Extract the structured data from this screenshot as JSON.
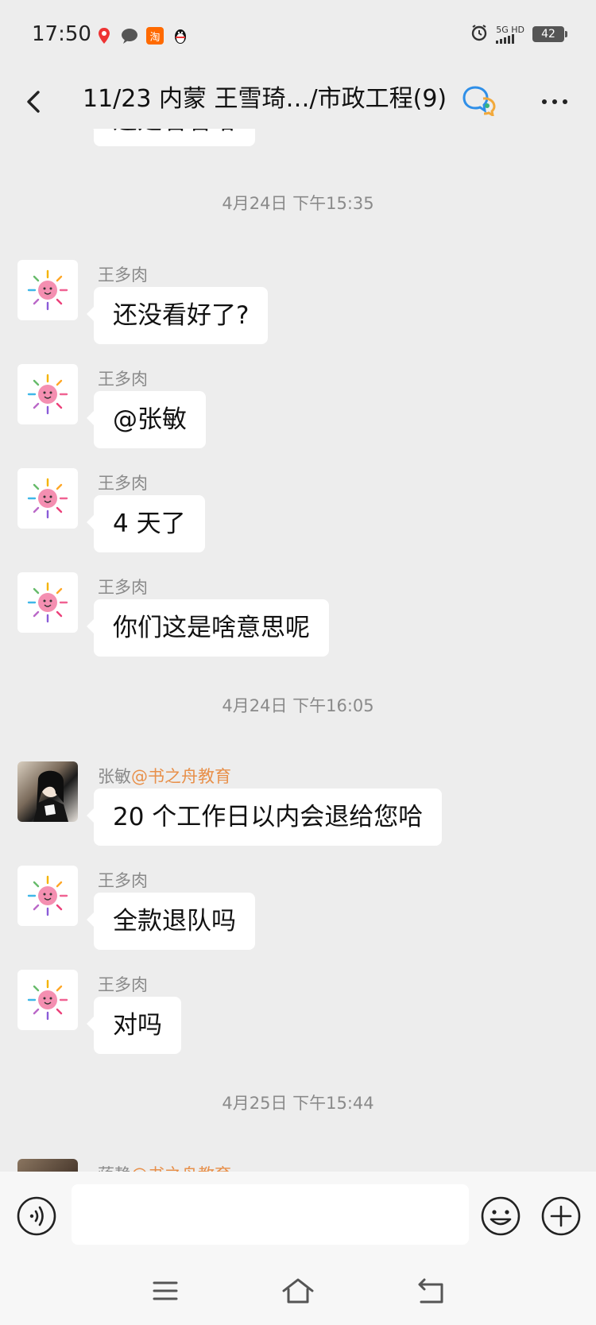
{
  "status_bar": {
    "time": "17:50",
    "notification_icons": [
      "location-pin-icon",
      "chat-bubble-icon",
      "taobao-icon",
      "qq-penguin-icon"
    ],
    "taobao_glyph": "淘",
    "network_label": "5G HD",
    "battery": "42"
  },
  "header": {
    "title": "11/23 内蒙 王雪琦…/市政工程(9)",
    "back_icon": "chevron-left-icon",
    "more_icon": "more-dots-icon"
  },
  "chat": {
    "top_partial_text": "这是看看哈",
    "timestamps": [
      "4月24日 下午15:35",
      "4月24日 下午16:05",
      "4月25日 下午15:44"
    ],
    "messages": [
      {
        "sender": "王多肉",
        "org": "",
        "text": "还没看好了?"
      },
      {
        "sender": "王多肉",
        "org": "",
        "text": "@张敏"
      },
      {
        "sender": "王多肉",
        "org": "",
        "text": "4 天了"
      },
      {
        "sender": "王多肉",
        "org": "",
        "text": "你们这是啥意思呢"
      },
      {
        "sender": "张敏",
        "org": "@书之舟教育",
        "text": "20 个工作日以内会退给您哈"
      },
      {
        "sender": "王多肉",
        "org": "",
        "text": "全款退队吗"
      },
      {
        "sender": "王多肉",
        "org": "",
        "text": "对吗"
      }
    ],
    "bottom_partial_sender": "蒋静",
    "bottom_partial_org": "@书之舟教育"
  },
  "input_bar": {
    "placeholder": "",
    "voice_icon": "voice-icon",
    "emoji_icon": "emoji-icon",
    "plus_icon": "plus-icon"
  },
  "system_nav": {
    "icons": [
      "menu-icon",
      "home-icon",
      "back-icon"
    ]
  },
  "colors": {
    "background": "#ededed",
    "bubble": "#ffffff",
    "meta_text": "#8a8a8a",
    "org_text": "#e8904a"
  }
}
